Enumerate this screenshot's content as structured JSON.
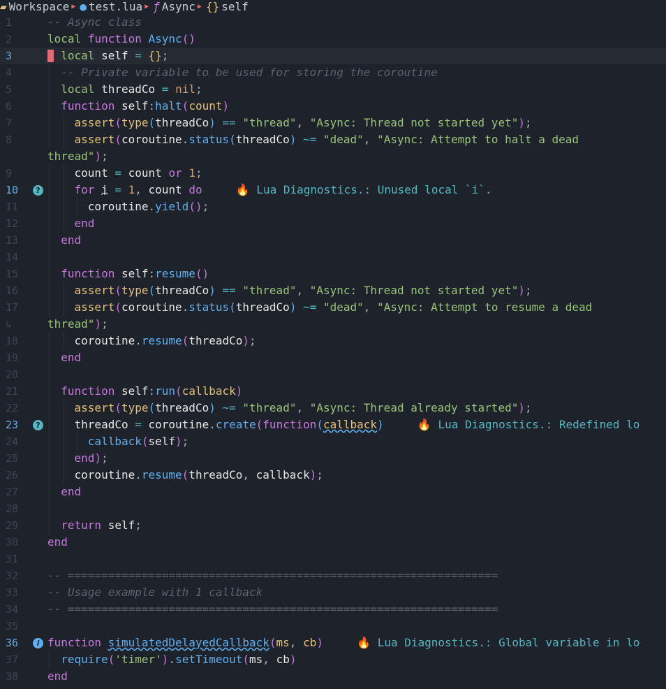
{
  "breadcrumb": {
    "workspace": "Workspace",
    "file": "test.lua",
    "func": "Async",
    "obj": "self"
  },
  "lines": [
    {
      "num": "1"
    },
    {
      "num": "2"
    },
    {
      "num": "3"
    },
    {
      "num": "4"
    },
    {
      "num": "5"
    },
    {
      "num": "6"
    },
    {
      "num": "7"
    },
    {
      "num": "8"
    },
    {
      "num": "9"
    },
    {
      "num": "10"
    },
    {
      "num": "11"
    },
    {
      "num": "12"
    },
    {
      "num": "13"
    },
    {
      "num": "14"
    },
    {
      "num": "15"
    },
    {
      "num": "16"
    },
    {
      "num": "17"
    },
    {
      "num": "18"
    },
    {
      "num": "19"
    },
    {
      "num": "20"
    },
    {
      "num": "21"
    },
    {
      "num": "22"
    },
    {
      "num": "23"
    },
    {
      "num": "24"
    },
    {
      "num": "25"
    },
    {
      "num": "26"
    },
    {
      "num": "27"
    },
    {
      "num": "28"
    },
    {
      "num": "29"
    },
    {
      "num": "30"
    },
    {
      "num": "31"
    },
    {
      "num": "32"
    },
    {
      "num": "33"
    },
    {
      "num": "34"
    },
    {
      "num": "35"
    },
    {
      "num": "36"
    },
    {
      "num": "37"
    },
    {
      "num": "38"
    }
  ],
  "wrap_mark": "↳",
  "diagnostics": {
    "line10": "Lua Diagnostics.: Unused local `i`.",
    "line23": "Lua Diagnostics.: Redefined lo",
    "line36": "Lua Diagnostics.: Global variable in lo"
  },
  "code": {
    "l1": "-- Async class",
    "l4": "-- Private variable to be used for storing the coroutine",
    "l7_s1": "\"thread\"",
    "l7_s2": "\"Async: Thread not started yet\"",
    "l8_s1": "\"dead\"",
    "l8_s2a": "\"Async: Attempt to halt a dead",
    "l8_s2b": "thread\"",
    "l16_s1": "\"thread\"",
    "l16_s2": "\"Async: Thread not started yet\"",
    "l17_s1": "\"dead\"",
    "l17_s2a": "\"Async: Attempt to resume a dead",
    "l17_s2b": "thread\"",
    "l21_s1": "\"thread\"",
    "l21_s2": "\"Async: Thread already started\"",
    "l32": "-- ================================================================",
    "l33": "-- Usage example with 1 callback",
    "l34": "-- ================================================================",
    "l37_s": "'timer'"
  },
  "colors": {
    "background": "#1e222a",
    "keyword": "#c678dd",
    "function": "#61afef",
    "string": "#98c379",
    "comment": "#5c6370",
    "diagnostic": "#56b6c2",
    "cursor": "#e06c75"
  }
}
